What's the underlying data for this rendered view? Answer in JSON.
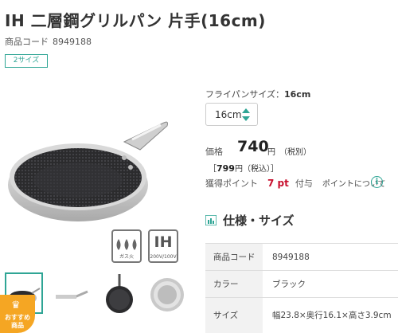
{
  "product": {
    "title": "IH 二層鋼グリルパン 片手(16cm)",
    "code_label": "商品コード",
    "code_value": "8949188",
    "size_badge": "2サイズ"
  },
  "feature_icons": {
    "gas_label": "ガス火",
    "ih_text": "IH",
    "ih_label": "200V/100V"
  },
  "badge": {
    "recommend": "おすすめ商品"
  },
  "options": {
    "size_label": "フライパンサイズ：",
    "size_value": "16cm",
    "select_value": "16cm"
  },
  "price": {
    "label": "価格",
    "value": "740",
    "yen": "円",
    "tax_note": "（税別）",
    "incl_open": "［",
    "incl_value": "799",
    "incl_yen": "円",
    "incl_note": "（税込）",
    "incl_close": "］"
  },
  "points": {
    "label": "獲得ポイント",
    "value": "7 pt",
    "suffix": "付与",
    "about": "ポイントについて"
  },
  "spec": {
    "heading": "仕様・サイズ",
    "rows": [
      {
        "key": "商品コード",
        "value": "8949188"
      },
      {
        "key": "カラー",
        "value": "ブラック"
      },
      {
        "key": "サイズ",
        "value": "幅23.8×奥行16.1×高さ3.9cm"
      }
    ]
  },
  "colors": {
    "accent": "#2fa595",
    "point": "#c8102e",
    "badge": "#f5a623"
  }
}
